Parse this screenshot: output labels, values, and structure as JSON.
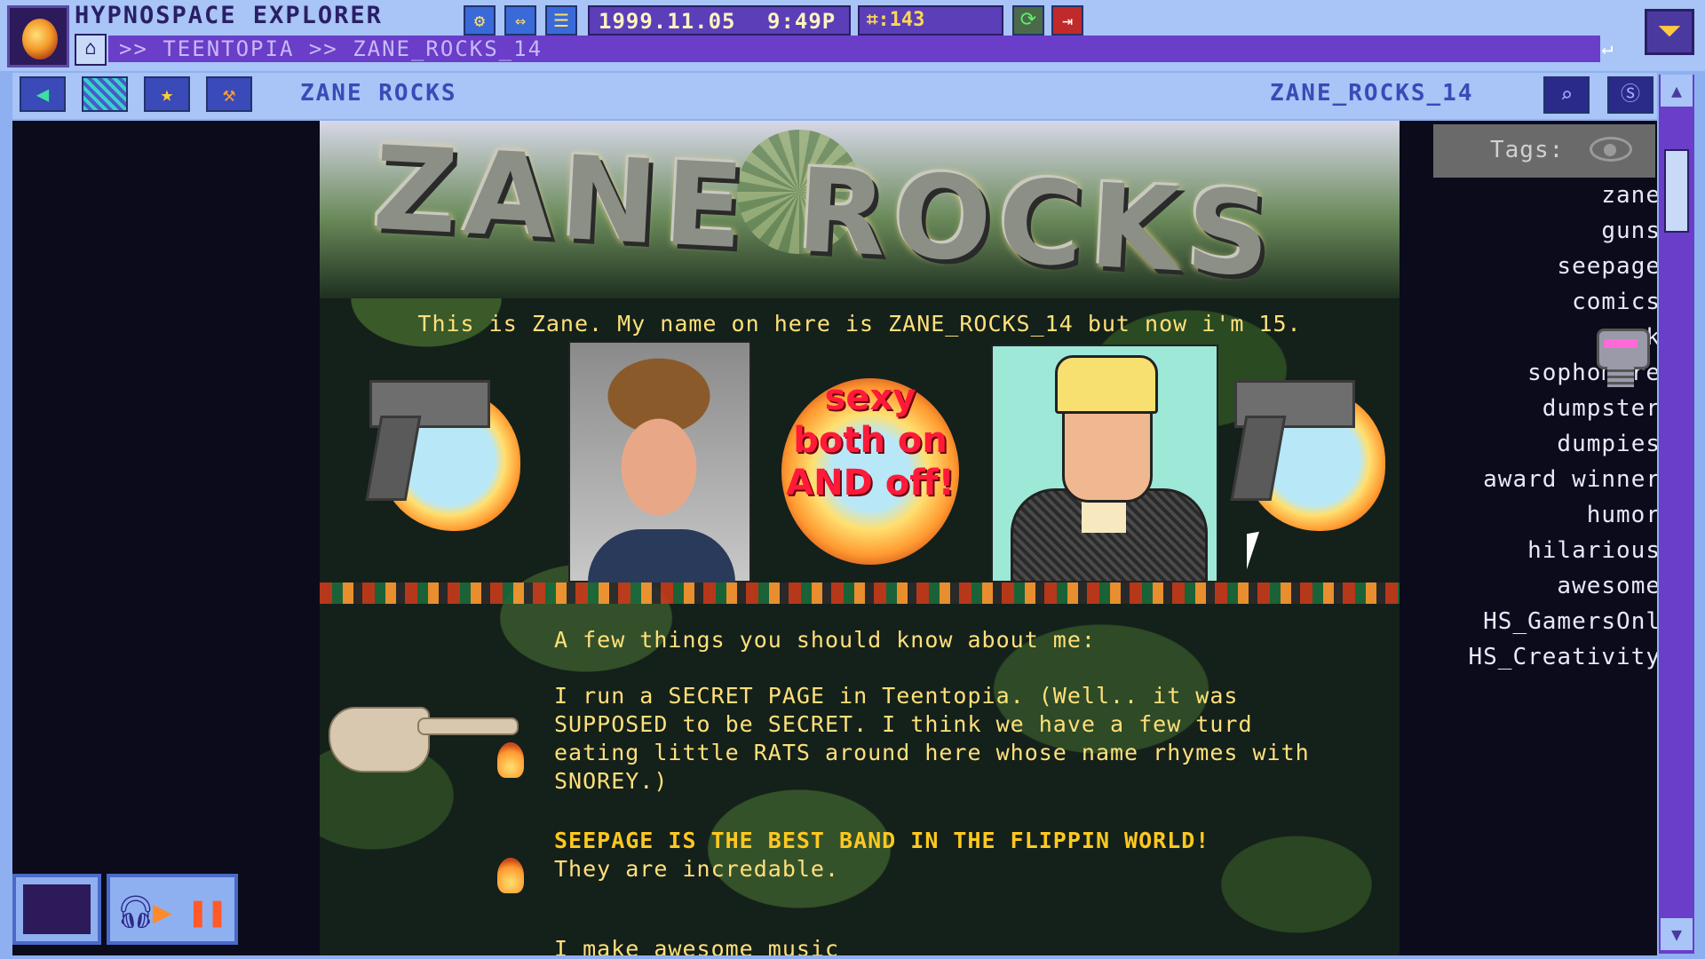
{
  "app": {
    "title": "HYPNOSPACE EXPLORER",
    "date": "1999.11.05",
    "time": "9:49P",
    "hypnocoin": "⌗:143"
  },
  "toolbar": {
    "breadcrumb": ">> TEENTOPIA >> ZANE_ROCKS_14",
    "page_name": "ZANE ROCKS",
    "page_id": "ZANE_ROCKS_14"
  },
  "page": {
    "banner_title": "ZANE ROCKS",
    "intro": "This is Zane. My name on here is ZANE_ROCKS_14 but now i'm 15.",
    "sexy_caption": "sexy both on AND off!",
    "about_heading": "A few things you should know about me:",
    "about_paragraph": "I run a SECRET PAGE in Teentopia. (Well.. it was SUPPOSED to be SECRET. I think we have a few turd eating little RATS around here whose name rhymes with SNOREY.)",
    "band_line": "SEEPAGE IS THE BEST BAND IN THE FLIPPIN WORLD!",
    "band_line_2": "They are incredable.",
    "partial_line": "I make awesome music"
  },
  "tags": {
    "header": "Tags:",
    "items": [
      "zane",
      "guns",
      "seepage",
      "comics",
      "punk",
      "sophomore",
      "dumpster",
      "dumpies",
      "award winner",
      "humor",
      "hilarious",
      "awesome",
      "HS_GamersOnl",
      "HS_Creativity"
    ]
  },
  "icons": {
    "title_bar": [
      "settings-icon",
      "resize-icon",
      "menu-icon",
      "sync-icon",
      "exit-icon",
      "minimize-icon"
    ],
    "toolbar": [
      "back-arrow-icon",
      "checker-icon",
      "star-icon",
      "hammer-icon",
      "search-icon",
      "hs-coin-icon"
    ]
  },
  "colors": {
    "accent": "#6a3ec8",
    "text_yellow": "#ffe07a",
    "sexy_red": "#ff1a3a"
  }
}
